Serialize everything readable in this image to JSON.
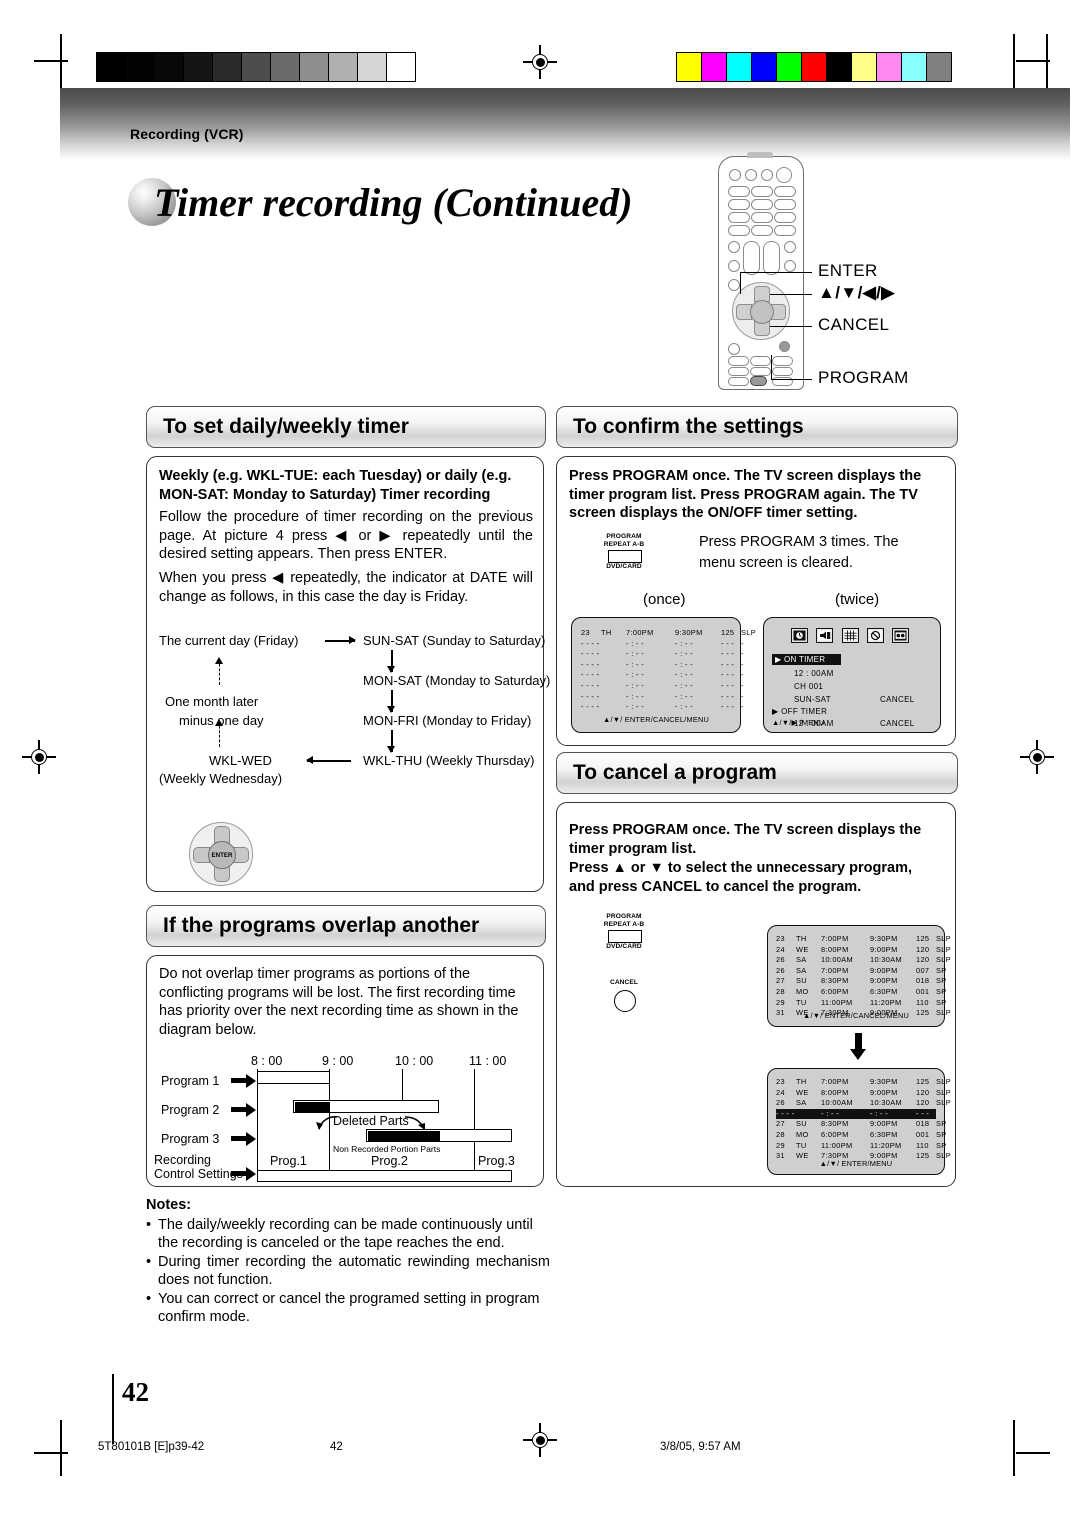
{
  "header": {
    "breadcrumb": "Recording (VCR)",
    "title": "Timer recording (Continued)"
  },
  "remote": {
    "callouts": [
      {
        "label": "ENTER"
      },
      {
        "label": "▲/▼/◀/▶"
      },
      {
        "label": "CANCEL"
      },
      {
        "label": "PROGRAM"
      }
    ]
  },
  "sections": {
    "daily_weekly": {
      "heading": "To set daily/weekly timer",
      "bold_intro": "Weekly (e.g. WKL-TUE: each Tuesday) or daily (e.g. MON-SAT: Monday to Saturday) Timer recording",
      "para1": "Follow the procedure of timer recording on the previous page. At picture 4 press ◀ or ▶ repeatedly until the desired setting appears. Then press ENTER.",
      "para2": "When you press ◀ repeatedly, the indicator at DATE will change as follows, in this case the day is Friday.",
      "cycle": {
        "current_day": "The current day (Friday)",
        "one_month_1": "One month later",
        "one_month_2": "minus one day",
        "wkl_wed": "WKL-WED",
        "wkl_wed_sub": "(Weekly Wednesday)",
        "sun_sat": "SUN-SAT (Sunday to Saturday)",
        "mon_sat": "MON-SAT (Monday to Saturday)",
        "mon_fri": "MON-FRI (Monday to Friday)",
        "wkl_thu": "WKL-THU (Weekly Thursday)"
      },
      "dpad_center_label": "ENTER"
    },
    "overlap": {
      "heading": "If the programs overlap another",
      "para": "Do not overlap timer programs as portions of the conflicting programs will be lost. The first recording time has priority over the next recording time as shown in the diagram below.",
      "timeline": {
        "times": [
          "8 : 00",
          "9 : 00",
          "10 : 00",
          "11 : 00"
        ],
        "rows": [
          "Program 1",
          "Program 2",
          "Program 3"
        ],
        "control_label_1": "Recording",
        "control_label_2": "Control Settings",
        "deleted_parts": "Deleted Parts",
        "non_recorded": "Non Recorded Portion Parts",
        "result_blocks": [
          "Prog.1",
          "Prog.2",
          "Prog.3"
        ]
      }
    },
    "confirm": {
      "heading": "To confirm the settings",
      "bold_intro": "Press PROGRAM once. The TV screen displays the timer program list. Press PROGRAM again. The TV screen displays the ON/OFF timer setting.",
      "note_line1": "Press PROGRAM 3 times. The",
      "note_line2": "menu screen is cleared.",
      "button": {
        "line1": "PROGRAM",
        "line2": "REPEAT A-B",
        "line3": "DVD/CARD"
      },
      "caption_once": "(once)",
      "caption_twice": "(twice)",
      "screen_once": {
        "header_row": [
          "23",
          "TH",
          "7:00PM",
          "9:30PM",
          "125",
          "SLP"
        ],
        "blank_rows": 7,
        "footer": "▲/▼/ ENTER/CANCEL/MENU"
      },
      "screen_twice": {
        "icons": [
          "clock-timer-icon",
          "audio-icon",
          "grid-icon",
          "no-signal-icon",
          "vcr-icon"
        ],
        "on_timer": "ON  TIMER",
        "on_time": "12 : 00AM",
        "on_channel": "CH 001",
        "on_days": "SUN-SAT",
        "on_cancel": "CANCEL",
        "off_timer": "OFF TIMER",
        "off_time": "12 : 00AM",
        "off_cancel": "CANCEL",
        "footer": "▲/▼/▶ /MENU"
      }
    },
    "cancel": {
      "heading": "To cancel a program",
      "bold_line1": "Press PROGRAM once. The TV screen displays the",
      "bold_line2": "timer program list.",
      "bold_line3": "Press ▲ or ▼ to select the unnecessary program,",
      "bold_line4": "and press CANCEL to cancel the program.",
      "program_button": {
        "line1": "PROGRAM",
        "line2": "REPEAT A-B",
        "line3": "DVD/CARD"
      },
      "cancel_button": {
        "label": "CANCEL"
      },
      "list_top": {
        "rows": [
          [
            "23",
            "TH",
            "7:00PM",
            "9:30PM",
            "125",
            "SLP"
          ],
          [
            "24",
            "WE",
            "8:00PM",
            "9:00PM",
            "120",
            "SLP"
          ],
          [
            "26",
            "SA",
            "10:00AM",
            "10:30AM",
            "120",
            "SLP"
          ],
          [
            "26",
            "SA",
            "7:00PM",
            "9:00PM",
            "007",
            "SP"
          ],
          [
            "27",
            "SU",
            "8:30PM",
            "9:00PM",
            "018",
            "SP"
          ],
          [
            "28",
            "MO",
            "6:00PM",
            "6:30PM",
            "001",
            "SP"
          ],
          [
            "29",
            "TU",
            "11:00PM",
            "11:20PM",
            "110",
            "SP"
          ],
          [
            "31",
            "WE",
            "7:30PM",
            "9:00PM",
            "125",
            "SLP"
          ]
        ],
        "footer": "▲/▼/ ENTER/CANCEL/MENU"
      },
      "list_bottom": {
        "rows": [
          [
            "23",
            "TH",
            "7:00PM",
            "9:30PM",
            "125",
            "SLP"
          ],
          [
            "24",
            "WE",
            "8:00PM",
            "9:00PM",
            "120",
            "SLP"
          ],
          [
            "26",
            "SA",
            "10:00AM",
            "10:30AM",
            "120",
            "SLP"
          ],
          [
            "",
            "",
            "",
            "",
            "",
            ""
          ],
          [
            "27",
            "SU",
            "8:30PM",
            "9:00PM",
            "018",
            "SP"
          ],
          [
            "28",
            "MO",
            "6:00PM",
            "6:30PM",
            "001",
            "SP"
          ],
          [
            "29",
            "TU",
            "11:00PM",
            "11:20PM",
            "110",
            "SP"
          ],
          [
            "31",
            "WE",
            "7:30PM",
            "9:00PM",
            "125",
            "SLP"
          ]
        ],
        "highlighted_row_index": 3,
        "footer": "▲/▼/ ENTER/MENU"
      }
    }
  },
  "notes": {
    "title": "Notes:",
    "items": [
      "The daily/weekly recording can be made continuously until the recording is canceled or the tape reaches the end.",
      "During timer recording the automatic rewinding mechanism does not function.",
      "You can correct or cancel the programed setting in program confirm mode."
    ]
  },
  "page": {
    "number": "42"
  },
  "footer": {
    "doc_id": "5T80101B [E]p39-42",
    "page_label": "42",
    "timestamp": "3/8/05, 9:57 AM"
  },
  "colors": {
    "gray_scale": [
      "#000000",
      "#030303",
      "#080808",
      "#141414",
      "#2a2a2a",
      "#4d4d4d",
      "#6b6b6b",
      "#8e8e8e",
      "#b0b0b0",
      "#d6d6d6",
      "#ffffff"
    ],
    "color_bar": [
      "#ffff00",
      "#ff00ff",
      "#00ffff",
      "#0000ff",
      "#00ff00",
      "#ff0000",
      "#000000",
      "#ffff88",
      "#ff88ee",
      "#88ffff",
      "#808080"
    ]
  }
}
